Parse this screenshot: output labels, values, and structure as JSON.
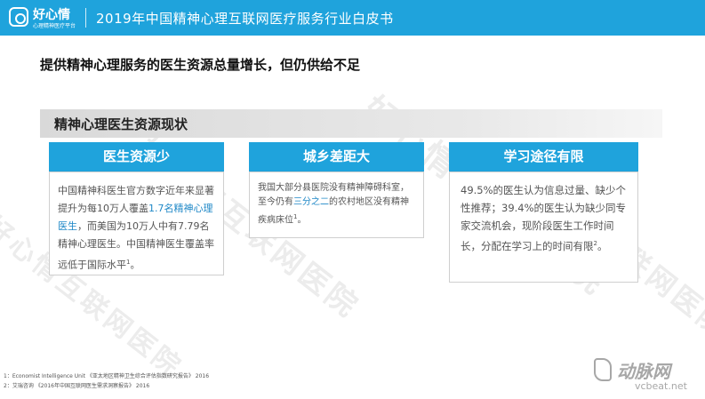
{
  "header": {
    "logo_name": "好心情",
    "logo_tagline": "心理精神医疗平台",
    "title": "2019年中国精神心理互联网医疗服务行业白皮书"
  },
  "watermark_text": "好心情互联网医院",
  "subtitle": "提供精神心理服务的医生资源总量增长，但仍供给不足",
  "section_title": "精神心理医生资源现状",
  "cards": [
    {
      "title": "医生资源少",
      "text_before": "中国精神科医生官方数字近年来显著提升为每10万人覆盖",
      "highlight": "1.7名精神心理医生",
      "text_after": "，而美国为10万人中有7.79名精神心理医生。中国精神医生覆盖率远低于国际水平",
      "ref": "1",
      "text_end": "。"
    },
    {
      "title": "城乡差距大",
      "text_before": "我国大部分县医院没有精神障碍科室，至今仍有",
      "highlight": "三分之二",
      "text_after": "的农村地区没有精神疾病床位",
      "ref": "1",
      "text_end": "。"
    },
    {
      "title": "学习途径有限",
      "text_before": "49.5%的医生认为信息过量、缺少个性推荐；39.4%的医生认为缺少同专家交流机会，现阶段医生工作时间长，分配在学习上的时间有限",
      "highlight": "",
      "text_after": "",
      "ref": "2",
      "text_end": "。"
    }
  ],
  "footnotes": [
    "1：Economist Intelligence Unit 《亚太地区精神卫生综合评估指数研究报告》 2016",
    "2：艾瑞咨询 《2016年中国互联网医生需求洞察报告》 2016"
  ],
  "brand": {
    "name": "动脉网",
    "url": "vcbeat.net"
  },
  "colors": {
    "accent": "#1fa3dc",
    "highlight": "#1f88c7"
  }
}
